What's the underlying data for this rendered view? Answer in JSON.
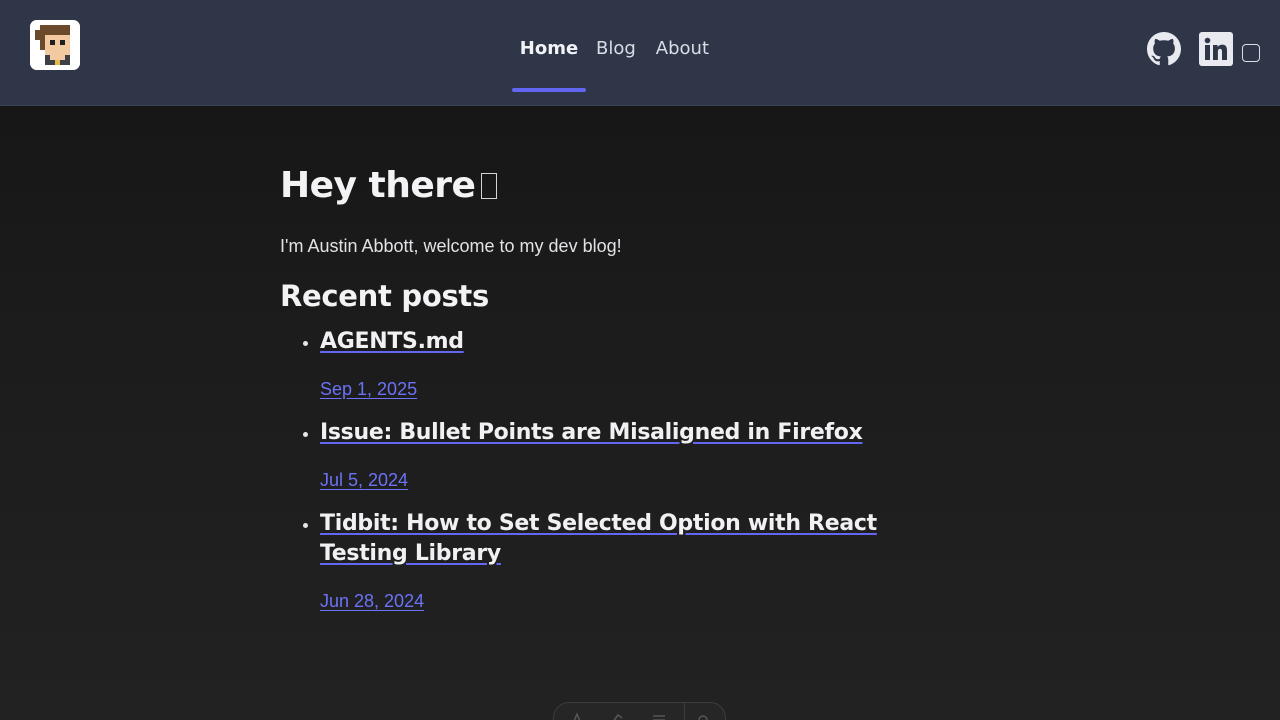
{
  "header": {
    "logo_icon": "pixel-avatar-logo",
    "nav": [
      {
        "label": "Home",
        "active": true
      },
      {
        "label": "Blog",
        "active": false
      },
      {
        "label": "About",
        "active": false
      }
    ],
    "social": [
      {
        "icon": "github-icon"
      },
      {
        "icon": "linkedin-icon"
      }
    ],
    "theme_toggle_icon": "checkbox-toggle-icon",
    "accent_color": "#6366f1"
  },
  "hero": {
    "title": "Hey there",
    "title_emoji_glyph": "missing-glyph-box",
    "intro": "I'm Austin Abbott, welcome to my dev blog!"
  },
  "recent_posts": {
    "heading": "Recent posts",
    "items": [
      {
        "title": "AGENTS.md",
        "date": "Sep 1, 2025"
      },
      {
        "title": "Issue: Bullet Points are Misaligned in Firefox",
        "date": "Jul 5, 2024"
      },
      {
        "title": "Tidbit: How to Set Selected Option with React Testing Library",
        "date": "Jun 28, 2024"
      }
    ]
  },
  "colors": {
    "header_bg": "#2e3648",
    "page_bg": "#1b1b1b",
    "link_date": "#6b72f5"
  }
}
